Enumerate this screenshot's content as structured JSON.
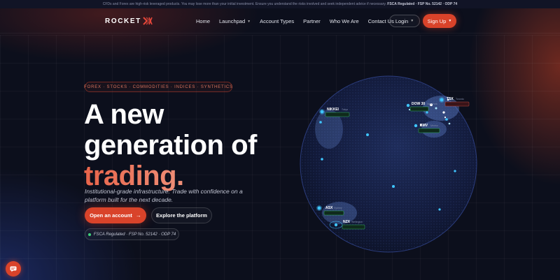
{
  "disclaimer": {
    "text": "CFDs and Forex are high-risk leveraged products. You may lose more than your initial investment. Ensure you understand the risks involved and seek independent advice if necessary.",
    "reg": "FSCA Regulated · FSP No. 52142 · ODP 74"
  },
  "brand": {
    "name": "ROCKET"
  },
  "nav": {
    "items": [
      {
        "label": "Home"
      },
      {
        "label": "Launchpad",
        "dropdown": true
      },
      {
        "label": "Account Types"
      },
      {
        "label": "Partner"
      },
      {
        "label": "Who We Are"
      },
      {
        "label": "Contact Us"
      }
    ],
    "login": "Login",
    "signup": "Sign Up"
  },
  "hero": {
    "markets": "FOREX · STOCKS · COMMODITIES · INDICES · SYNTHETICS",
    "line1": "A new",
    "line2": "generation of",
    "line3": "trading.",
    "sub": "Institutional-grade infrastructure. Trade with confidence on a platform built for the next decade.",
    "cta_primary": "Open an account",
    "cta_secondary": "Explore the platform",
    "reg": "FSCA Regulated · FSP No. 52142 · ODP 74"
  },
  "globe": {
    "markers": [
      {
        "name": "TSX",
        "city": "Toronto"
      },
      {
        "name": "NIKKEI",
        "city": "Tokyo"
      },
      {
        "name": "DOW 30",
        "city": "New York"
      },
      {
        "name": "BMV",
        "city": "Mexico"
      },
      {
        "name": "ASX",
        "city": "Sydney"
      },
      {
        "name": "NZX",
        "city": "Wellington"
      }
    ]
  },
  "colors": {
    "accent": "#d9432a",
    "background": "#0c0f1c",
    "marker": "#3fc6ff",
    "badge": "#3fd17a"
  },
  "icons": {
    "chat": "chat-icon",
    "logo_mark": "rocket-x-icon",
    "arrow": "arrow-right-icon"
  }
}
